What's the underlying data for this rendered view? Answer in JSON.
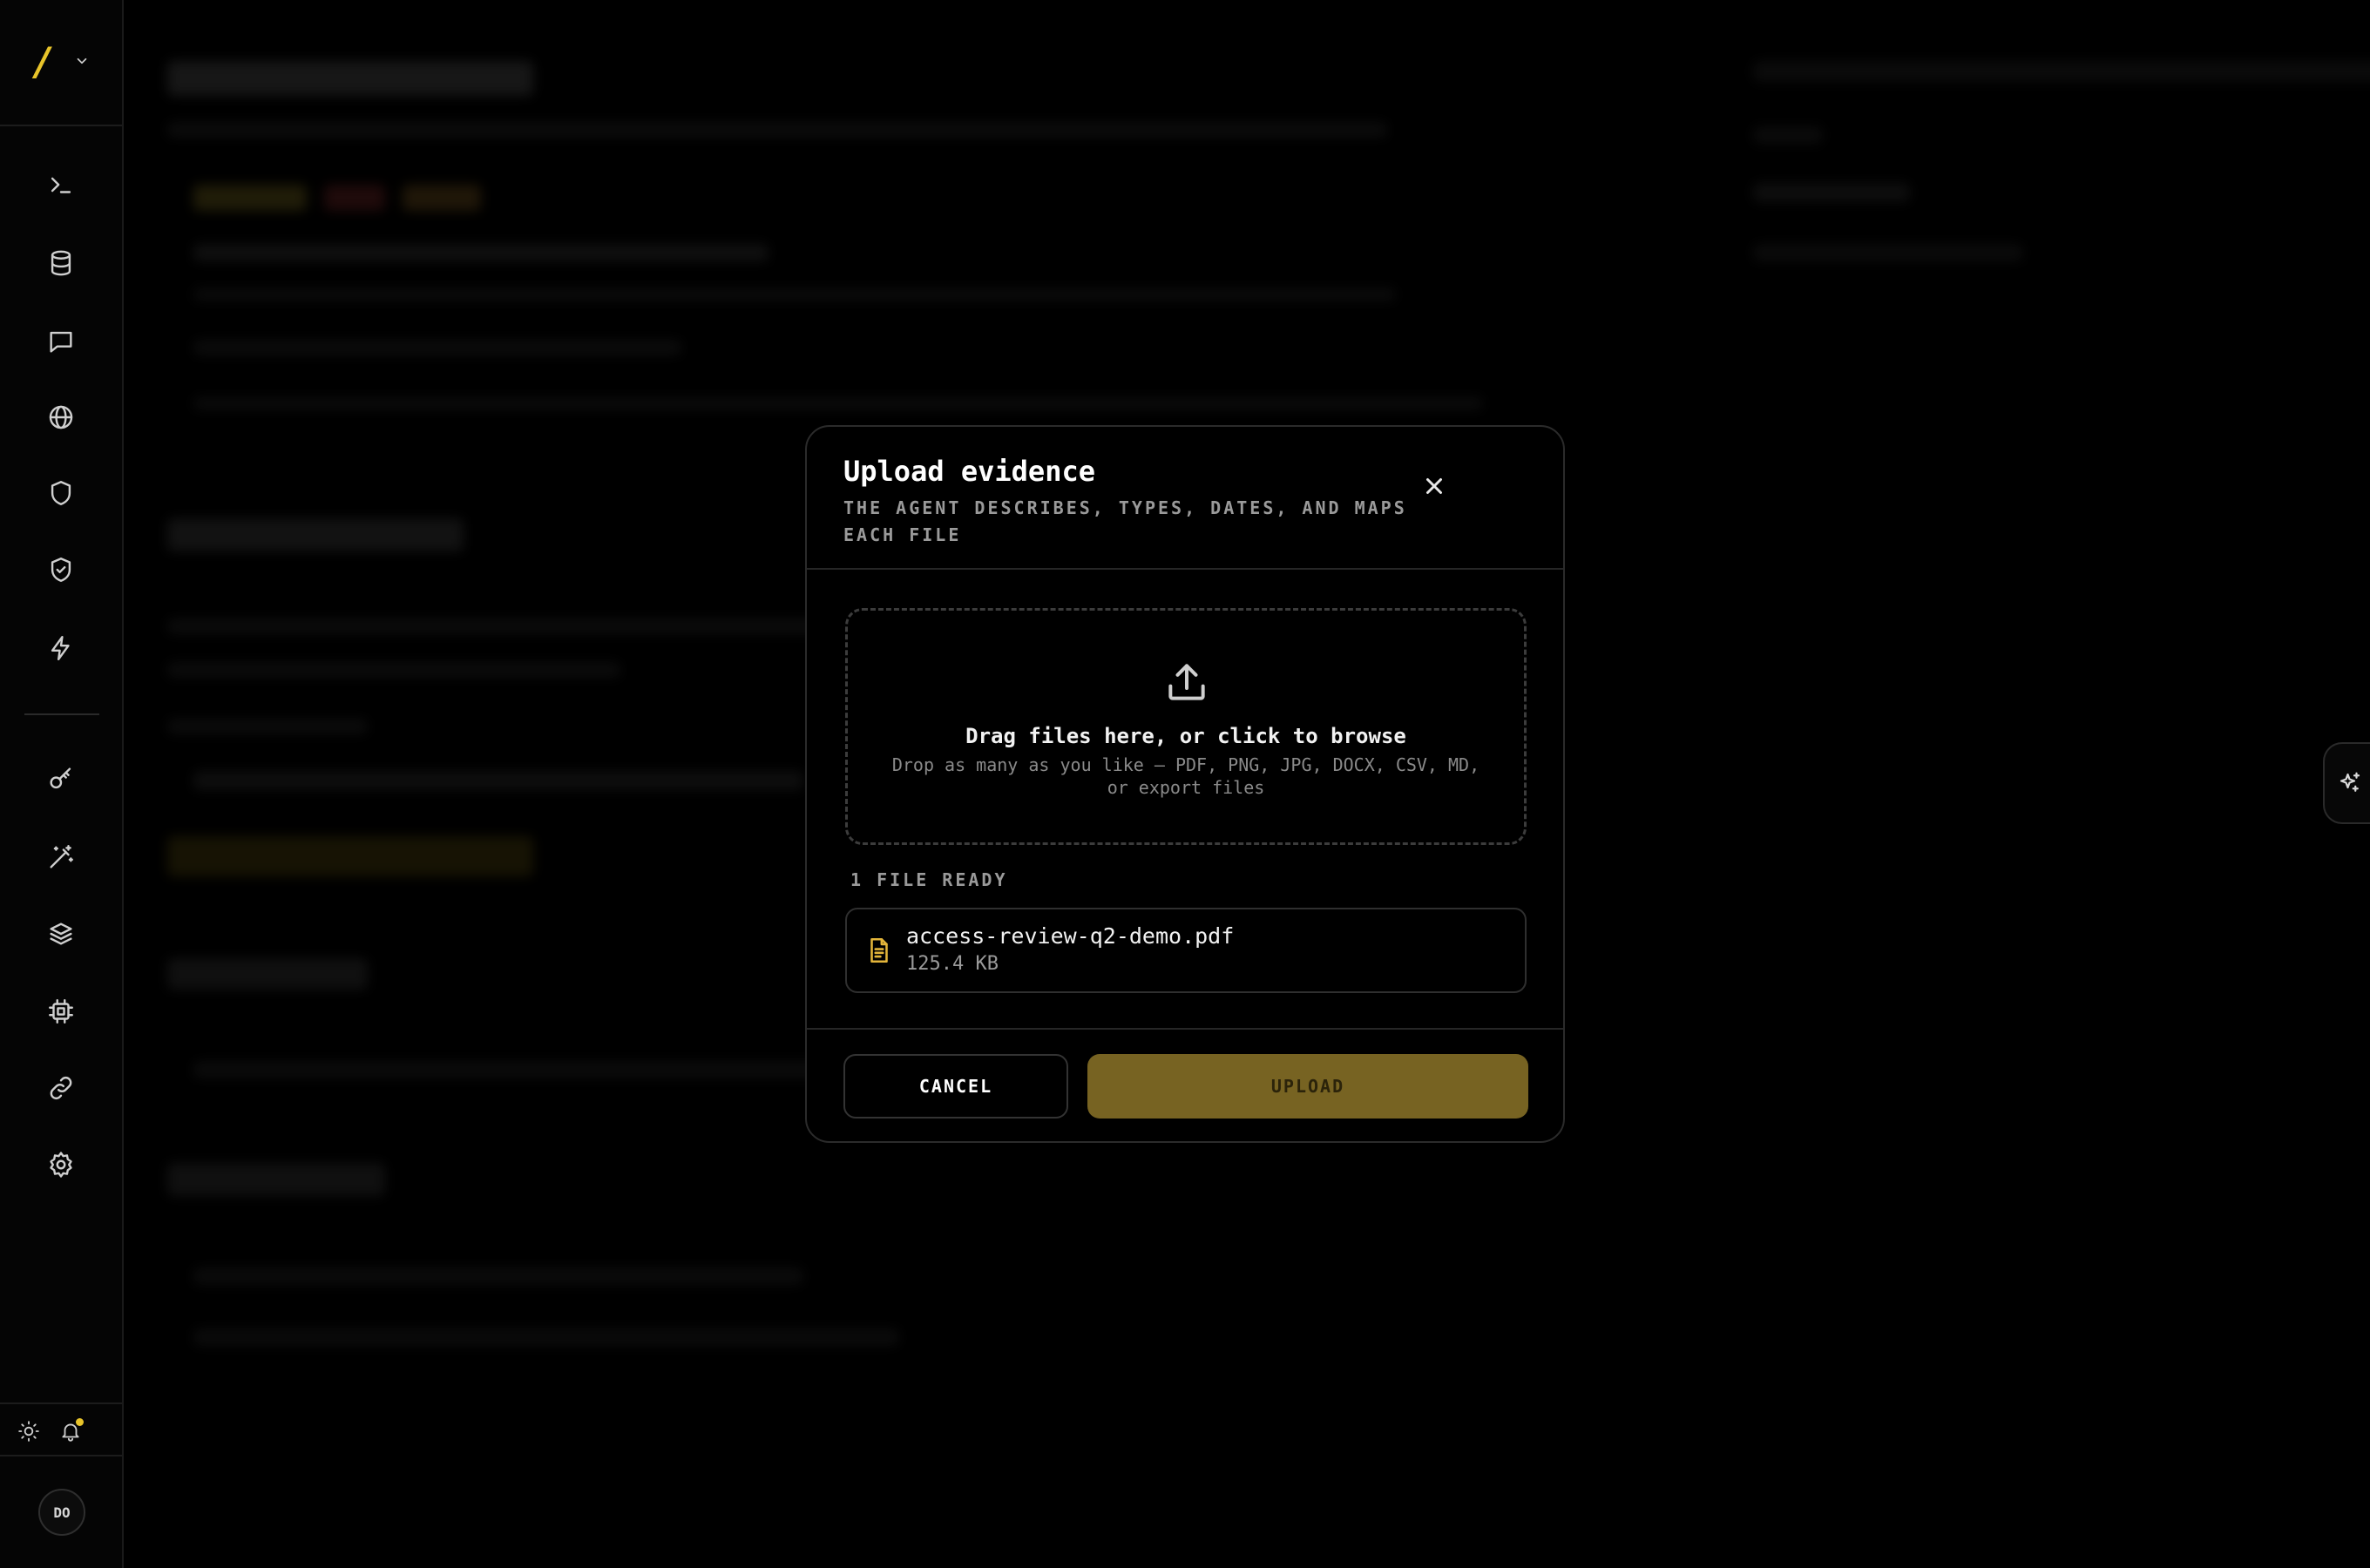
{
  "app": {
    "logo_text": "/"
  },
  "sidebar": {
    "items": [
      {
        "name": "terminal"
      },
      {
        "name": "database"
      },
      {
        "name": "chat"
      },
      {
        "name": "globe"
      },
      {
        "name": "shield"
      },
      {
        "name": "shield-check"
      },
      {
        "name": "lightning"
      },
      {
        "name": "key"
      },
      {
        "name": "magic-wand"
      },
      {
        "name": "layers"
      },
      {
        "name": "chip"
      },
      {
        "name": "link"
      },
      {
        "name": "settings"
      }
    ],
    "user_initials": "DO"
  },
  "modal": {
    "title": "Upload evidence",
    "subtitle": "THE AGENT DESCRIBES, TYPES, DATES, AND MAPS EACH FILE",
    "dropzone": {
      "title": "Drag files here, or click to browse",
      "hint": "Drop as many as you like — PDF, PNG, JPG, DOCX, CSV, MD, or export files"
    },
    "ready_label": "1 FILE READY",
    "files": [
      {
        "name": "access-review-q2-demo.pdf",
        "size": "125.4 KB"
      }
    ],
    "cancel_label": "CANCEL",
    "upload_label": "UPLOAD"
  },
  "colors": {
    "accent": "#e8c42a",
    "upload_button": "#776322",
    "file_icon": "#e3b53a",
    "background": "#000000"
  }
}
